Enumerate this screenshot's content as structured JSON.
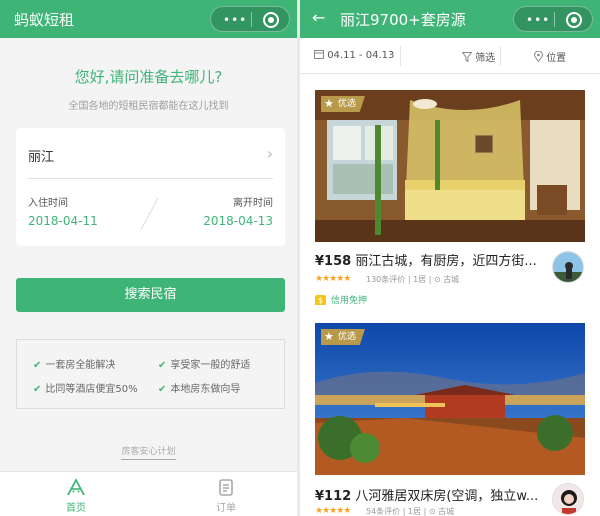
{
  "left": {
    "title": "蚂蚁短租",
    "menu_dots": "•••",
    "greeting": "您好,请问准备去哪儿?",
    "subgreeting": "全国各地的短租民宿都能在这儿找到",
    "city": "丽江",
    "checkin_label": "入住时间",
    "checkin_date": "2018-04-11",
    "checkout_label": "离开时间",
    "checkout_date": "2018-04-13",
    "search_button": "搜索民宿",
    "features": [
      "一套房全能解决",
      "享受家一般的舒适",
      "比同等酒店便宜50%",
      "本地房东做向导"
    ],
    "plan_link": "房客安心计划",
    "tabs": [
      {
        "label": "首页",
        "icon": "home-icon",
        "active": true
      },
      {
        "label": "订单",
        "icon": "orders-icon",
        "active": false
      }
    ]
  },
  "right": {
    "title": "丽江9700+套房源",
    "menu_dots": "•••",
    "date_range": "04.11 - 04.13",
    "filter_label": "筛选",
    "location_label": "位置",
    "listings": [
      {
        "badge": "优选",
        "price": "¥158",
        "title": "丽江古城，有厨房，近四方街...",
        "stars": "★★★★★",
        "reviews": "130条评价",
        "rooms": "1居",
        "area": "古城",
        "credit": "信用免押"
      },
      {
        "badge": "优选",
        "price": "¥112",
        "title": "八河雅居双床房(空调，独立w...",
        "stars": "★★★★★",
        "reviews": "54条评价",
        "rooms": "1居",
        "area": "古城"
      }
    ]
  },
  "colors": {
    "brand": "#3eb577",
    "star": "#f5a623",
    "badge": "#b99a4b"
  }
}
